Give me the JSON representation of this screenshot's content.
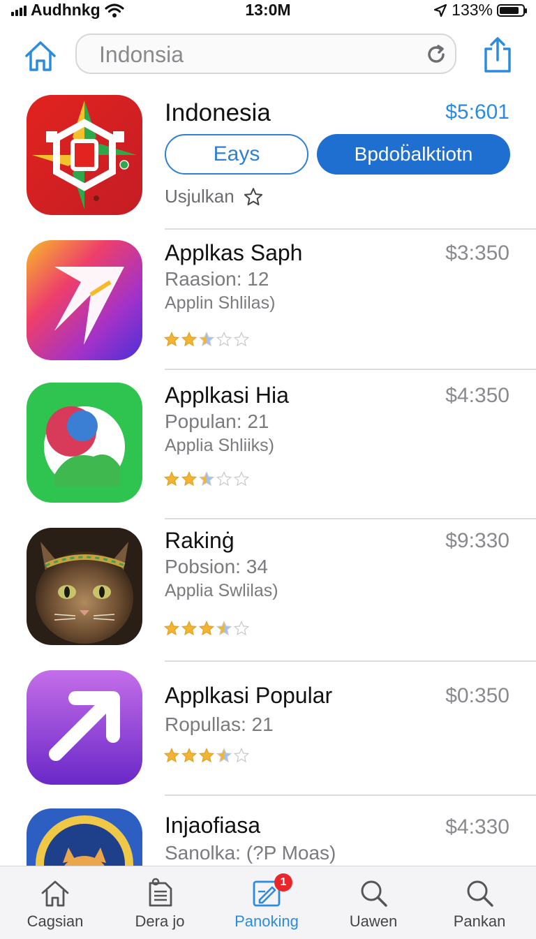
{
  "status_bar": {
    "carrier": "Audhnkg",
    "time": "13:0M",
    "battery": "133%",
    "battery_level": 0.85
  },
  "nav": {
    "search_value": "Indonsia",
    "icons": [
      "home-icon",
      "reload-icon",
      "share-icon"
    ]
  },
  "featured": {
    "title": "Indonesia",
    "price": "$5:601",
    "button_outline": "Eays",
    "button_solid": "Bpdob̈alktiotn",
    "subtitle": "Usjulkan"
  },
  "apps": [
    {
      "name": "Applkas Saph",
      "price": "$3:350",
      "line2": "Raasion: 12",
      "line3": "Applin Shlilas)",
      "rating": 2.5
    },
    {
      "name": "Applkasi  Hia",
      "price": "$4:350",
      "line2": "Populan: 21",
      "line3": "Applia Shliiks)",
      "rating": 2.5
    },
    {
      "name": "Rakinġ",
      "price": "$9:330",
      "line2": "Pobsion: 34",
      "line3": "Applia Swlilas)",
      "rating": 3.5
    },
    {
      "name": "Applkasi Popular",
      "price": "$0:350",
      "line2": "Ropullas: 21",
      "line3": "",
      "rating": 3.5
    },
    {
      "name": "Injaofiasa",
      "price": "$4:330",
      "line2": "Sanolka: (?P Moas)",
      "line3": "",
      "rating": 0
    }
  ],
  "tabs": [
    {
      "label": "Cagsian",
      "icon": "home-icon"
    },
    {
      "label": "Dera jo",
      "icon": "document-icon"
    },
    {
      "label": "Panoking",
      "icon": "edit-icon",
      "badge": "1",
      "active": true
    },
    {
      "label": "Uawen",
      "icon": "search-icon"
    },
    {
      "label": "Pankan",
      "icon": "search-icon"
    }
  ],
  "colors": {
    "accent": "#2b8cdf",
    "button_solid": "#1f6fd0",
    "badge": "#e8262c",
    "star": "#f2b533"
  }
}
